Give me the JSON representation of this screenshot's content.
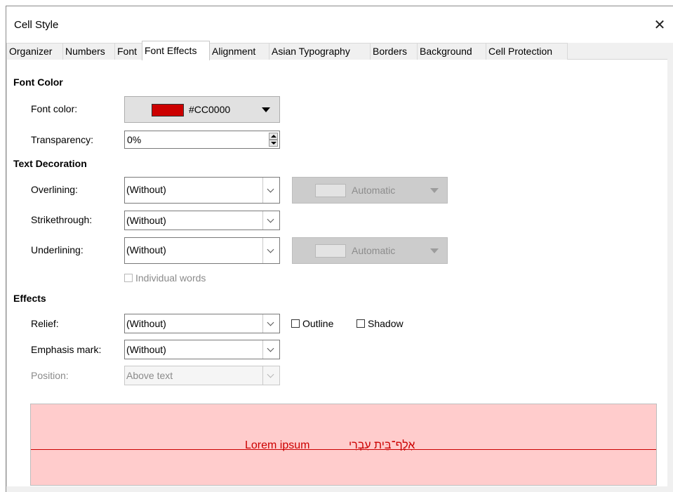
{
  "dialog": {
    "title": "Cell Style"
  },
  "tabs": [
    "Organizer",
    "Numbers",
    "Font",
    "Font Effects",
    "Alignment",
    "Asian Typography",
    "Borders",
    "Background",
    "Cell Protection"
  ],
  "active_tab": "Font Effects",
  "font_color": {
    "section": "Font Color",
    "color_label": "Font color:",
    "color_value": "#CC0000",
    "swatch_color": "#cc0000",
    "transparency_label": "Transparency:",
    "transparency_value": "0%"
  },
  "text_decoration": {
    "section": "Text Decoration",
    "overlining_label": "Overlining:",
    "overlining_value": "(Without)",
    "overlining_color": "Automatic",
    "strikethrough_label": "Strikethrough:",
    "strikethrough_value": "(Without)",
    "underlining_label": "Underlining:",
    "underlining_value": "(Without)",
    "underlining_color": "Automatic",
    "individual_words": "Individual words"
  },
  "effects": {
    "section": "Effects",
    "relief_label": "Relief:",
    "relief_value": "(Without)",
    "outline_label": "Outline",
    "shadow_label": "Shadow",
    "emphasis_label": "Emphasis mark:",
    "emphasis_value": "(Without)",
    "position_label": "Position:",
    "position_value": "Above text"
  },
  "preview": {
    "latin_text": "Lorem ipsum",
    "hebrew_text": "אָלֶף־בֵּית עִבְרִי",
    "background": "#ffcccc",
    "text_color": "#cc0000"
  }
}
